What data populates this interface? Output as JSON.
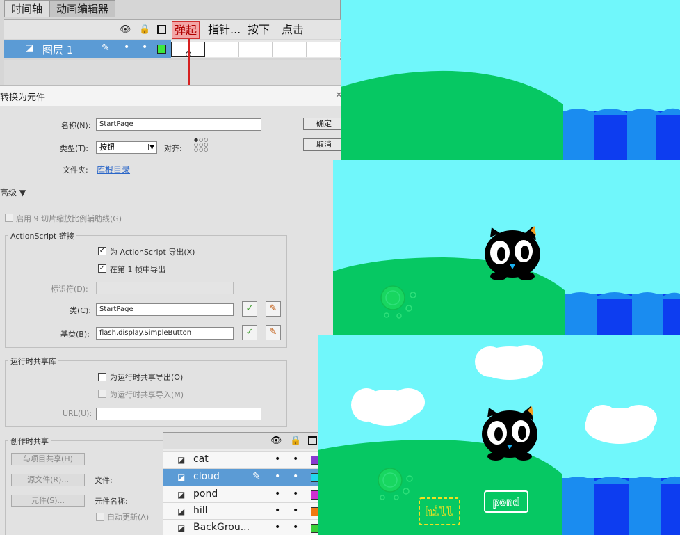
{
  "timeline": {
    "tabs": [
      "时间轴",
      "动画编辑器"
    ],
    "frame_labels": [
      "弹起",
      "指针...",
      "按下",
      "点击"
    ],
    "layer_name": "图层 1"
  },
  "dialog": {
    "title": "转换为元件",
    "close": "×",
    "name_label": "名称(N):",
    "name_value": "StartPage",
    "type_label": "类型(T):",
    "type_value": "按钮",
    "align_label": "对齐:",
    "folder_label": "文件夹:",
    "folder_link": "库根目录",
    "ok": "确定",
    "cancel": "取消",
    "advanced": "高级 ▼",
    "slice9": "启用 9 切片缩放比例辅助线(G)",
    "as_linkage_title": "ActionScript 链接",
    "export_as": "为 ActionScript 导出(X)",
    "export_frame1": "在第 1 帧中导出",
    "identifier_label": "标识符(D):",
    "class_label": "类(C):",
    "class_value": "StartPage",
    "base_label": "基类(B):",
    "base_value": "flash.display.SimpleButton",
    "runtime_title": "运行时共享库",
    "runtime_export": "为运行时共享导出(O)",
    "runtime_import": "为运行时共享导入(M)",
    "url_label": "URL(U):",
    "authoring_title": "创作时共享",
    "share_project": "与项目共享(H)",
    "source_file": "源文件(R)...",
    "file_label": "文件:",
    "symbol_btn": "元件(S)...",
    "symbol_name_label": "元件名称:",
    "auto_update": "自动更新(A)"
  },
  "layers_panel": {
    "layers": [
      {
        "name": "cat",
        "color": "#8a3ad0"
      },
      {
        "name": "cloud",
        "color": "#22d6ee"
      },
      {
        "name": "pond",
        "color": "#d030d0"
      },
      {
        "name": "hill",
        "color": "#f07a10"
      },
      {
        "name": "BackGrou...",
        "color": "#3ad03a"
      }
    ],
    "selected": "cloud"
  },
  "scenes": {
    "sky_color": "#70f7fb",
    "hill_color": "#06c863",
    "water_colors": [
      "#1a8cf0",
      "#0d3df0"
    ],
    "hill_sign": "hill",
    "pond_sign": "pond"
  }
}
